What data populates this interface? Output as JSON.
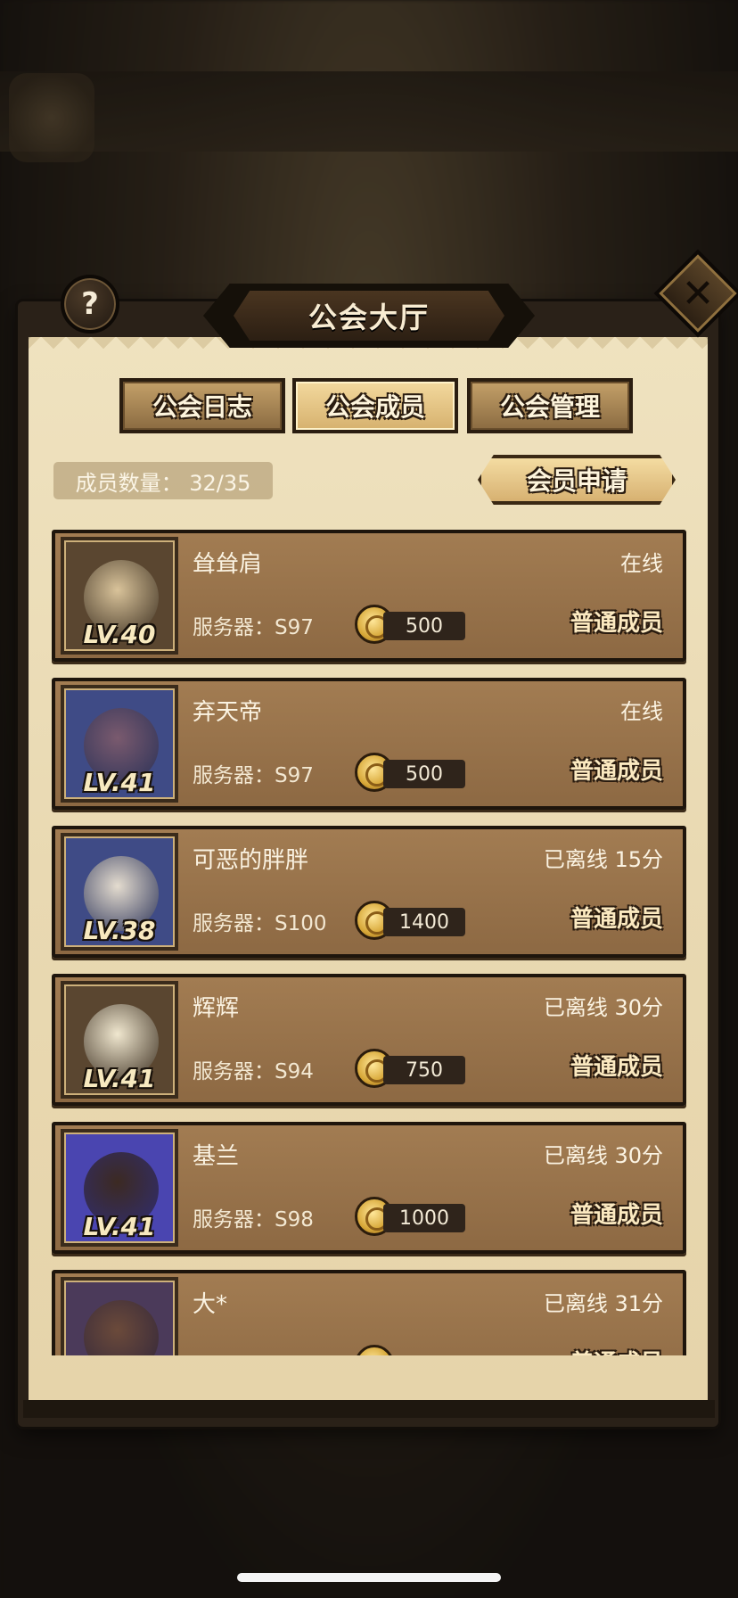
{
  "title": "公会大厅",
  "help_icon": "question-mark-icon",
  "close_icon": "close-x-icon",
  "help_label": "?",
  "close_label": "✕",
  "tabs": [
    {
      "label": "公会日志",
      "active": false
    },
    {
      "label": "公会成员",
      "active": true
    },
    {
      "label": "公会管理",
      "active": false
    }
  ],
  "member_count": "成员数量： 32/35",
  "apply_button": "会员申请",
  "members": [
    {
      "name": "耸耸肩",
      "status": "在线",
      "level": "LV.40",
      "server": "服务器：S97",
      "contribution": "500",
      "role": "普通成员",
      "avatar_bg": "#5a4630",
      "avatar_face": "#d9c39a"
    },
    {
      "name": "弃天帝",
      "status": "在线",
      "level": "LV.41",
      "server": "服务器：S97",
      "contribution": "500",
      "role": "普通成员",
      "avatar_bg": "#3f4b86",
      "avatar_face": "#7a5a6e"
    },
    {
      "name": "可恶的胖胖",
      "status": "已离线 15分",
      "level": "LV.38",
      "server": "服务器：S100",
      "contribution": "1400",
      "role": "普通成员",
      "avatar_bg": "#3f4b86",
      "avatar_face": "#e4dccf"
    },
    {
      "name": "辉辉",
      "status": "已离线 30分",
      "level": "LV.41",
      "server": "服务器：S94",
      "contribution": "750",
      "role": "普通成员",
      "avatar_bg": "#5a4630",
      "avatar_face": "#f0e7cf"
    },
    {
      "name": "基兰",
      "status": "已离线 30分",
      "level": "LV.41",
      "server": "服务器：S98",
      "contribution": "1000",
      "role": "普通成员",
      "avatar_bg": "#4a45b0",
      "avatar_face": "#3c2a22"
    },
    {
      "name": "大*",
      "status": "已离线 31分",
      "level": "",
      "server": "",
      "contribution": "",
      "role": "普通成员",
      "avatar_bg": "#4b3a5a",
      "avatar_face": "#6b4a3a"
    }
  ],
  "colors": {
    "card": "#9a7549",
    "parchment": "#ecdcb6",
    "accent_gold": "#e8c887"
  }
}
